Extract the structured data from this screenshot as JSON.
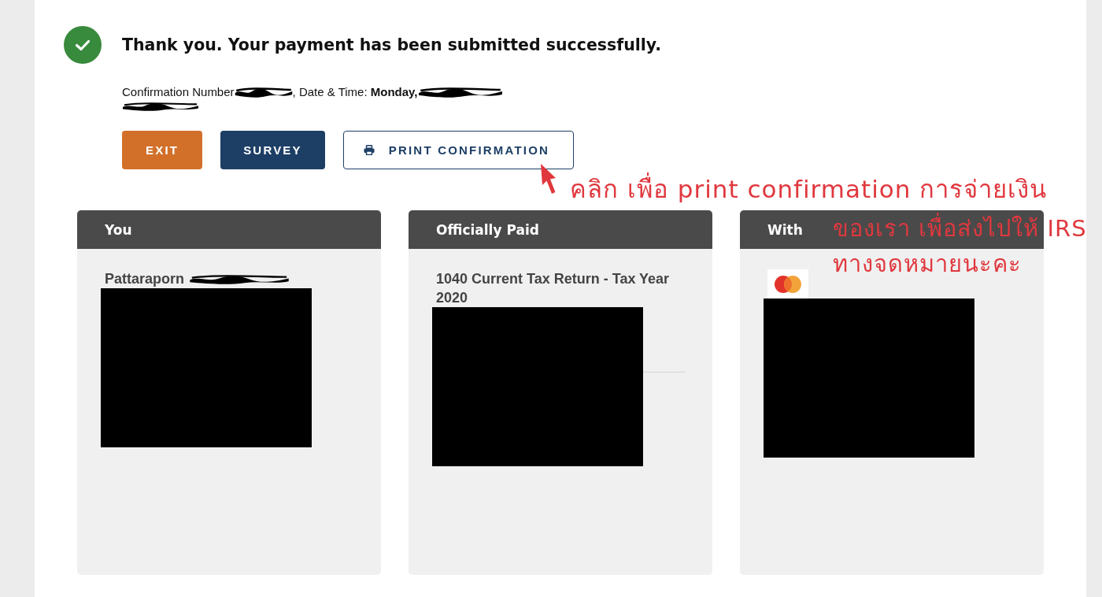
{
  "confirmation": {
    "title": "Thank you. Your payment has been submitted successfully.",
    "number_label": "Confirmation Number",
    "number_redacted": true,
    "date_time": ", Date & Time: **Monday,**",
    "date_redacted": true,
    "time_redacted": true
  },
  "buttons": [
    {
      "label": "EXIT",
      "kind": "accent"
    },
    {
      "label": "SURVEY",
      "kind": "primary"
    },
    {
      "label": "PRINT CONFIRMATION",
      "kind": "print"
    }
  ],
  "annotation": {
    "lines": [
      "คลิก เพื่อ print confirmation การจ่ายเงิน",
      "ของเรา เพื่อส่งไปให้ IRS",
      "ทางจดหมายนะคะ"
    ]
  },
  "cards": [
    {
      "heading": "You",
      "kind": "payer",
      "name": "Pattaraporn",
      "name_redacted": true,
      "details_redacted": true
    },
    {
      "heading": "Officially Paid",
      "kind": "payment",
      "description": "1040 Current Tax Return - Tax Year 2020",
      "details_redacted": true
    },
    {
      "heading": "With",
      "kind": "method",
      "details_redacted": true
    }
  ]
}
